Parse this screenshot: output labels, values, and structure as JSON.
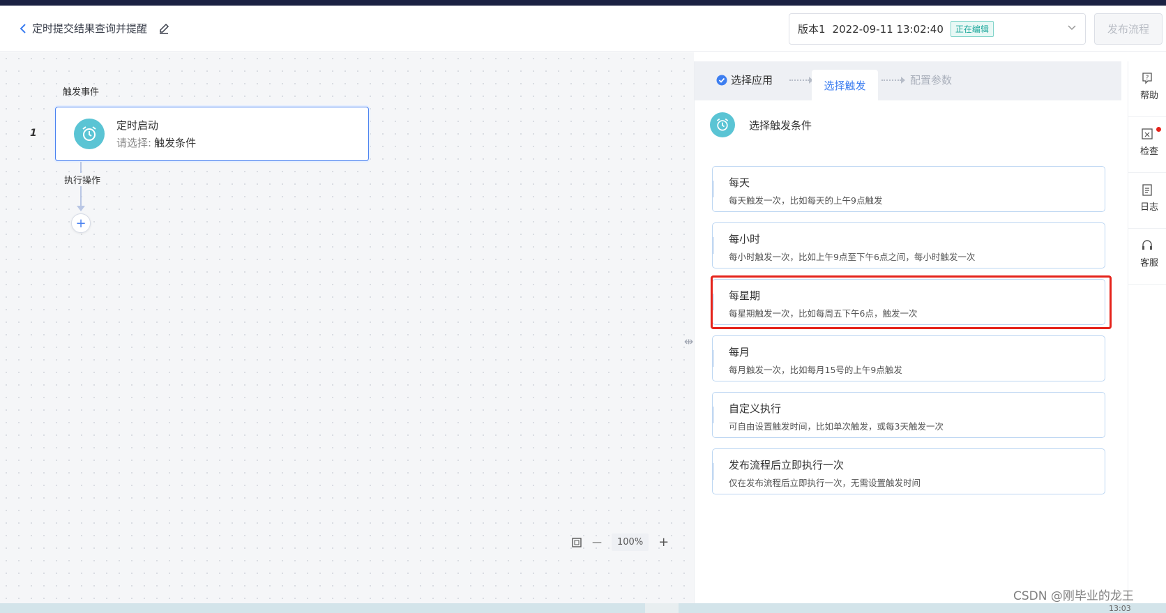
{
  "header": {
    "back_label": "定时提交结果查询并提醒",
    "version_label": "版本1",
    "version_time": "2022-09-11 13:02:40",
    "version_status": "正在编辑",
    "publish_label": "发布流程"
  },
  "canvas": {
    "trigger_section_label": "触发事件",
    "step_number": "1",
    "trigger_card": {
      "title": "定时启动",
      "prompt": "请选择:",
      "prompt_value": "触发条件"
    },
    "exec_label": "执行操作",
    "add_symbol": "+",
    "zoom": {
      "minus": "—",
      "value": "100%",
      "plus": "+"
    }
  },
  "panel": {
    "steps": [
      {
        "label": "选择应用",
        "state": "done"
      },
      {
        "label": "选择触发",
        "state": "active"
      },
      {
        "label": "配置参数",
        "state": "todo"
      }
    ],
    "header_title": "选择触发条件",
    "options": [
      {
        "title": "每天",
        "desc": "每天触发一次，比如每天的上午9点触发"
      },
      {
        "title": "每小时",
        "desc": "每小时触发一次，比如上午9点至下午6点之间，每小时触发一次"
      },
      {
        "title": "每星期",
        "desc": "每星期触发一次，比如每周五下午6点，触发一次"
      },
      {
        "title": "每月",
        "desc": "每月触发一次，比如每月15号的上午9点触发"
      },
      {
        "title": "自定义执行",
        "desc": "可自由设置触发时间，比如单次触发，或每3天触发一次"
      },
      {
        "title": "发布流程后立即执行一次",
        "desc": "仅在发布流程后立即执行一次，无需设置触发时间"
      }
    ],
    "highlighted_option": "每星期"
  },
  "rail": {
    "items": [
      {
        "label": "帮助",
        "icon": "help-icon"
      },
      {
        "label": "检查",
        "icon": "check-icon"
      },
      {
        "label": "日志",
        "icon": "log-icon"
      },
      {
        "label": "客服",
        "icon": "headset-icon"
      }
    ]
  },
  "watermark": {
    "text": "CSDN @刚毕业的龙王",
    "tail": "13:03"
  },
  "colors": {
    "accent": "#3d7ef0",
    "teal_icon": "#5ac4d4",
    "highlight": "#e5231b"
  }
}
